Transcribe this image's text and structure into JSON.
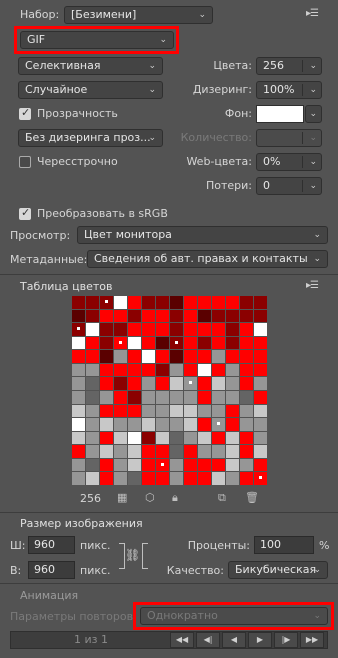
{
  "preset": {
    "label": "Набор:",
    "value": "[Безимени]"
  },
  "format": {
    "value": "GIF"
  },
  "reduction": {
    "value": "Селективная"
  },
  "colors": {
    "label": "Цвета:",
    "value": "256"
  },
  "dither_algo": {
    "value": "Случайное"
  },
  "dither": {
    "label": "Дизеринг:",
    "value": "100%"
  },
  "transparency": {
    "label": "Прозрачность",
    "checked": true
  },
  "matte": {
    "label": "Фон:"
  },
  "transparency_dither": {
    "value": "Без дизеринга проз..."
  },
  "amount": {
    "label": "Количество:",
    "value": ""
  },
  "interlaced": {
    "label": "Чересстрочно",
    "checked": false
  },
  "web_snap": {
    "label": "Web-цвета:",
    "value": "0%"
  },
  "lossy": {
    "label": "Потери:",
    "value": "0"
  },
  "convert_srgb": {
    "label": "Преобразовать в sRGB",
    "checked": true
  },
  "preview": {
    "label": "Просмотр:",
    "value": "Цвет монитора"
  },
  "metadata": {
    "label": "Метаданные:",
    "value": "Сведения об авт. правах и контакты"
  },
  "color_table": {
    "title": "Таблица цветов",
    "count": "256",
    "colors": {
      "red": "#ff0000",
      "darkred": "#8b0000",
      "maroon": "#5a0000",
      "black": "#000000",
      "white": "#ffffff",
      "lightgray": "#c8c8c8",
      "gray": "#969696",
      "darkgray": "#646464",
      "dim": "#3c3c3c"
    }
  },
  "image_size": {
    "title": "Размер изображения",
    "width_label": "Ш:",
    "width": "960",
    "width_unit": "пикс.",
    "height_label": "В:",
    "height": "960",
    "height_unit": "пикс.",
    "percent_label": "Проценты:",
    "percent": "100",
    "percent_unit": "%",
    "quality_label": "Качество:",
    "quality": "Бикубическая"
  },
  "animation": {
    "title": "Анимация",
    "loop_label": "Параметры повторов:",
    "loop_value": "Однократно",
    "frame_counter": "1 из 1"
  }
}
